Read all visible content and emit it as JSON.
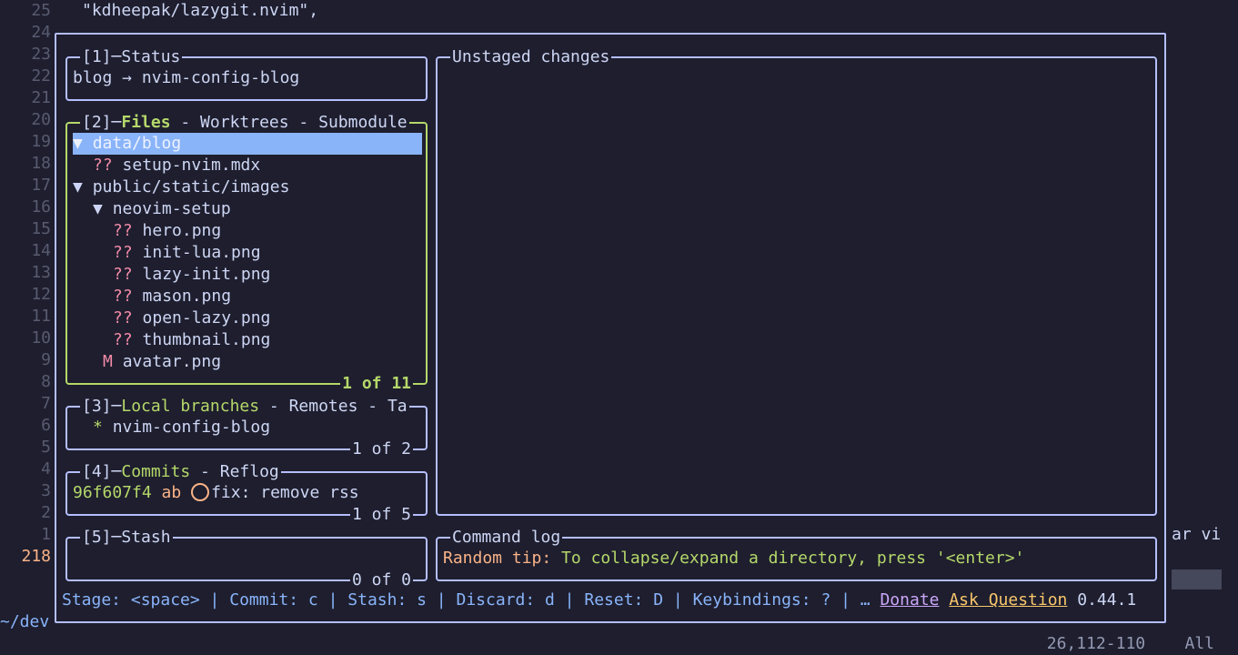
{
  "editor": {
    "top_line": "\"kdheepak/lazygit.nvim\",",
    "line_numbers": [
      "25",
      "24",
      "23",
      "22",
      "21",
      "20",
      "19",
      "18",
      "17",
      "16",
      "15",
      "14",
      "13",
      "12",
      "11",
      "10",
      "9",
      "8",
      "7",
      "6",
      "5",
      "4",
      "3",
      "2",
      "1",
      "218"
    ],
    "cwd": "~/dev",
    "right_cut_text": "ar vi",
    "position": "26,112-110",
    "scroll": "All"
  },
  "status_panel": {
    "title_num": "[1]",
    "title": "Status",
    "text": "blog → nvim-config-blog"
  },
  "files_panel": {
    "title_num": "[2]",
    "title_active": "Files",
    "title_rest": " - Worktrees - Submodule",
    "footer": "1 of 11",
    "items": [
      {
        "marker": "▼ ",
        "status": "",
        "name": "data/blog",
        "indent": 0,
        "selected": true
      },
      {
        "marker": "",
        "status": "?? ",
        "name": "setup-nvim.mdx",
        "indent": 1,
        "selected": false
      },
      {
        "marker": "▼ ",
        "status": "",
        "name": "public/static/images",
        "indent": 0,
        "selected": false
      },
      {
        "marker": "▼ ",
        "status": "",
        "name": "neovim-setup",
        "indent": 1,
        "selected": false
      },
      {
        "marker": "",
        "status": "?? ",
        "name": "hero.png",
        "indent": 2,
        "selected": false
      },
      {
        "marker": "",
        "status": "?? ",
        "name": "init-lua.png",
        "indent": 2,
        "selected": false
      },
      {
        "marker": "",
        "status": "?? ",
        "name": "lazy-init.png",
        "indent": 2,
        "selected": false
      },
      {
        "marker": "",
        "status": "?? ",
        "name": "mason.png",
        "indent": 2,
        "selected": false
      },
      {
        "marker": "",
        "status": "?? ",
        "name": "open-lazy.png",
        "indent": 2,
        "selected": false
      },
      {
        "marker": "",
        "status": "?? ",
        "name": "thumbnail.png",
        "indent": 2,
        "selected": false
      },
      {
        "marker": "",
        "status": "M ",
        "name": "avatar.png",
        "indent": 1.5,
        "selected": false
      }
    ]
  },
  "branches_panel": {
    "title_num": "[3]",
    "title_active": "Local branches",
    "title_rest": " - Remotes - Ta",
    "footer": "1 of 2",
    "branch_marker": "* ",
    "branch": "nvim-config-blog"
  },
  "commits_panel": {
    "title_num": "[4]",
    "title_active": "Commits",
    "title_rest": " - Reflog",
    "footer": "1 of 5",
    "hash": "96f607f4",
    "author": "ab",
    "message": "fix: remove rss"
  },
  "stash_panel": {
    "title_num": "[5]",
    "title": "Stash",
    "footer": "0 of 0"
  },
  "unstaged_panel": {
    "title": "Unstaged changes"
  },
  "command_log": {
    "title": "Command log",
    "tip_label": "Random tip:",
    "tip_text": " To collapse/expand a directory, press '<enter>'"
  },
  "bottom_bar": {
    "keys": "Stage: <space> | Commit: c | Stash: s | Discard: d | Reset: D | Keybindings: ? | … ",
    "donate": "Donate",
    "ask": "Ask Question",
    "version": "0.44.1"
  },
  "colors": {
    "background": "#1e1e2e",
    "border": "#b4befe",
    "active_border": "#b5d86a",
    "selection": "#89b4fa",
    "untracked": "#f38ba8",
    "tip": "#fab387"
  }
}
